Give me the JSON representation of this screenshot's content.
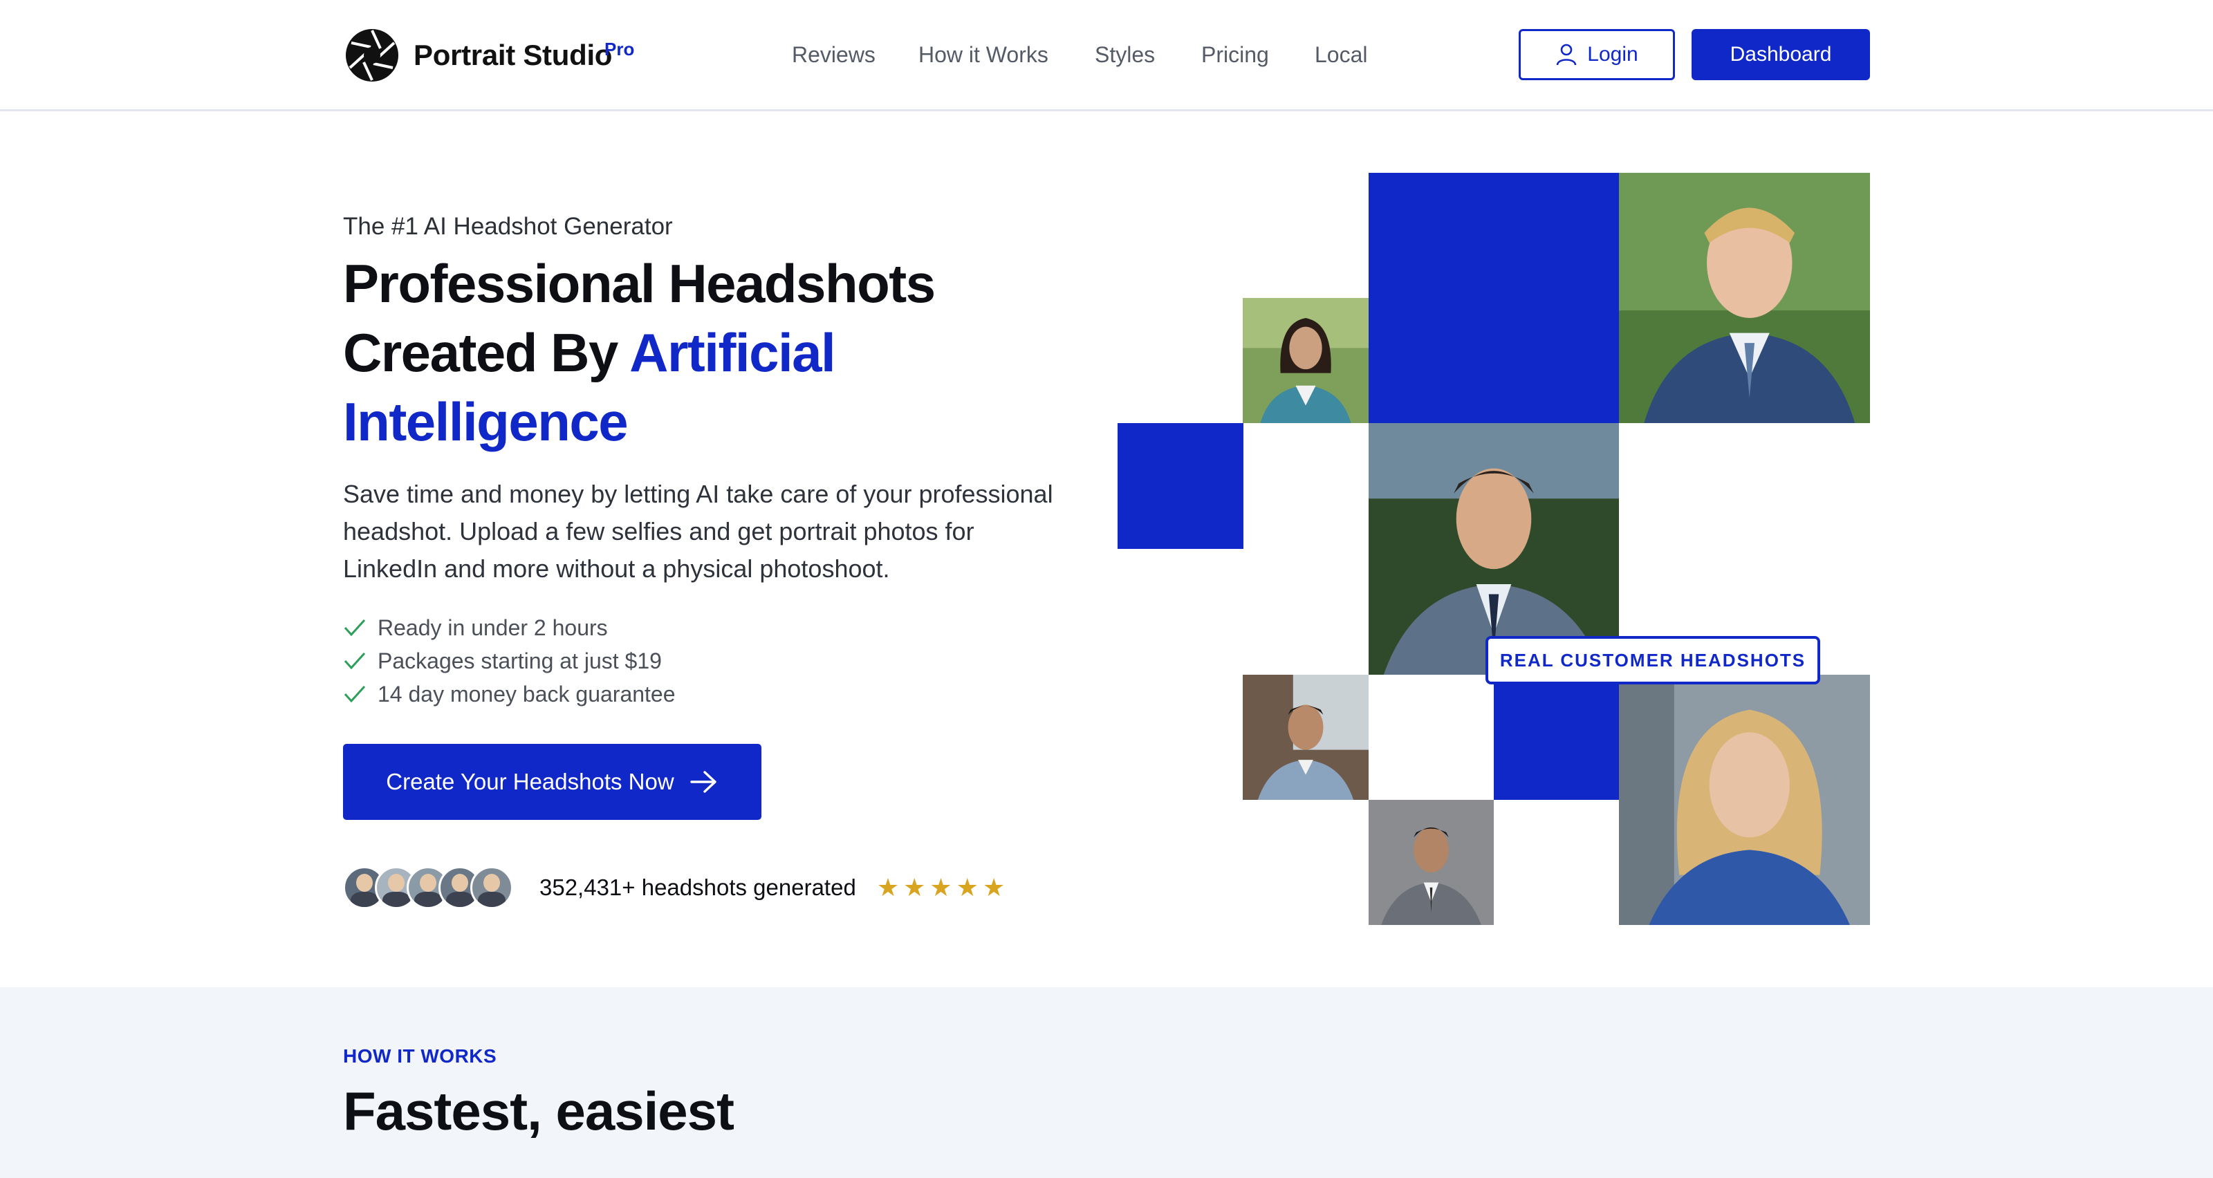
{
  "header": {
    "brand": "Portrait Studio",
    "brand_badge": "Pro",
    "nav": [
      "Reviews",
      "How it Works",
      "Styles",
      "Pricing",
      "Local"
    ],
    "login_label": "Login",
    "dashboard_label": "Dashboard"
  },
  "hero": {
    "eyebrow": "The #1 AI Headshot Generator",
    "title_part1": "Professional Headshots",
    "title_part2": "Created By ",
    "title_accent": "Artificial Intelligence",
    "lead": "Save time and money by letting AI take care of your professional headshot. Upload a few selfies and get portrait photos for LinkedIn and more without a physical photoshoot.",
    "checks": [
      "Ready in under 2 hours",
      "Packages starting at just $19",
      "14 day money back guarantee"
    ],
    "cta_label": "Create Your Headshots Now",
    "headshot_count": "352,431+ headshots generated",
    "stars": 5,
    "badge": "REAL CUSTOMER HEADSHOTS"
  },
  "how_it_works": {
    "eyebrow": "HOW IT WORKS",
    "title": "Fastest, easiest"
  },
  "colors": {
    "brand_blue": "#1128c9",
    "star": "#d9a520",
    "check": "#2f9e5a",
    "section_bg": "#f2f5fa"
  }
}
